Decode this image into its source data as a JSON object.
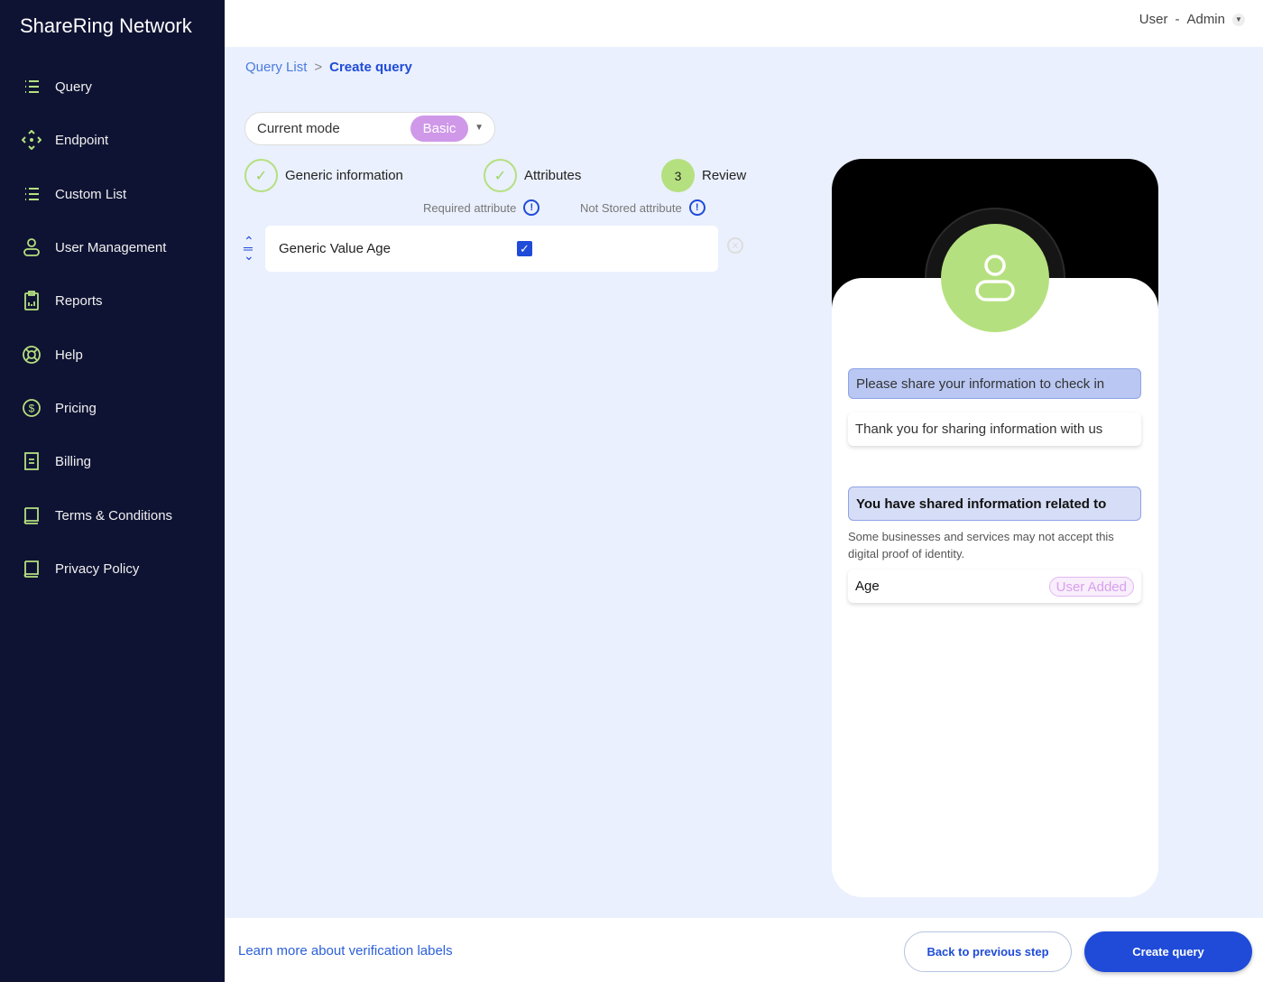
{
  "app": {
    "title": "ShareRing Network"
  },
  "sidebar": {
    "items": [
      {
        "label": "Query",
        "icon": "list-icon"
      },
      {
        "label": "Endpoint",
        "icon": "endpoint-icon"
      },
      {
        "label": "Custom List",
        "icon": "list-icon"
      },
      {
        "label": "User Management",
        "icon": "user-icon"
      },
      {
        "label": "Reports",
        "icon": "clipboard-icon"
      },
      {
        "label": "Help",
        "icon": "lifebuoy-icon"
      },
      {
        "label": "Pricing",
        "icon": "dollar-icon"
      },
      {
        "label": "Billing",
        "icon": "document-icon"
      },
      {
        "label": "Terms & Conditions",
        "icon": "book-icon"
      },
      {
        "label": "Privacy Policy",
        "icon": "book-icon"
      }
    ]
  },
  "header": {
    "user": "User",
    "separator": "-",
    "role": "Admin"
  },
  "breadcrumb": {
    "parent": "Query List",
    "separator": ">",
    "current": "Create query"
  },
  "mode": {
    "label": "Current mode",
    "value": "Basic"
  },
  "steps": [
    {
      "label": "Generic information",
      "status": "done"
    },
    {
      "label": "Attributes",
      "status": "done"
    },
    {
      "label": "Review",
      "number": "3",
      "status": "active"
    }
  ],
  "legend": {
    "required": "Required attribute",
    "not_stored": "Not Stored attribute",
    "info_symbol": "!"
  },
  "attributes": [
    {
      "name": "Generic Value Age",
      "checked": true
    }
  ],
  "preview": {
    "message1": "Please share your information to check in",
    "message2": "Thank you for sharing information with us",
    "shared_title": "You have shared information related to",
    "note": "Some businesses and services may not accept this digital proof of identity.",
    "items": [
      {
        "name": "Age",
        "badge": "User Added"
      }
    ]
  },
  "footer": {
    "learn_more": "Learn more about verification labels",
    "back": "Back to previous step",
    "create": "Create query"
  },
  "colors": {
    "sidebar": "#0f1333",
    "accent": "#1f4bd8",
    "green": "#b5e07f",
    "badge": "#cf98e8"
  }
}
